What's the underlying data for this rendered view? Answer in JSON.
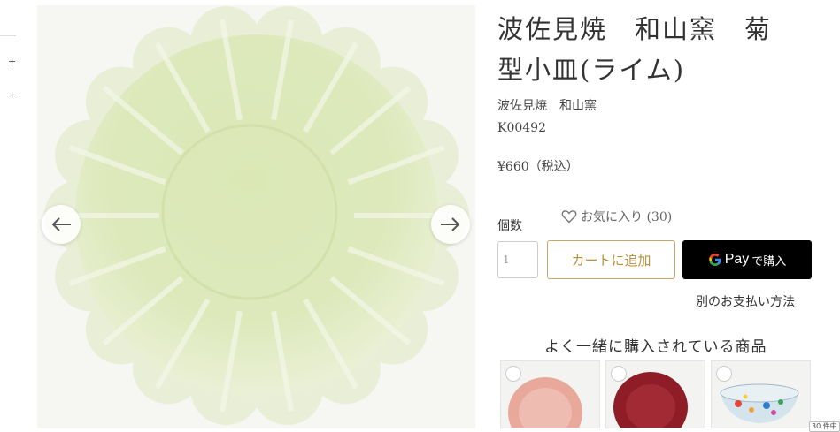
{
  "product": {
    "title_line1": "波佐見焼　和山窯　菊",
    "title_line2": "型小皿(ライム)",
    "maker": "波佐見焼　和山窯",
    "sku": "K00492",
    "price": "¥660（税込）"
  },
  "purchase": {
    "quantity_label": "個数",
    "favorite_label": "お気に入り (30)",
    "quantity_value": "1",
    "add_to_cart_label": "カートに追加",
    "gpay_label": "Pay",
    "gpay_buy_label": "で購入",
    "other_payment_label": "別のお支払い方法"
  },
  "related": {
    "title": "よく一緒に購入されている商品",
    "items": [
      {
        "name": "pink-plate",
        "color": "#e8a99a"
      },
      {
        "name": "red-plate",
        "color": "#8f1d27"
      },
      {
        "name": "glass-bowl",
        "color": "#d4e4ec"
      }
    ]
  },
  "badge": "30 件中",
  "colors": {
    "plate_lime": "#dbe9b8",
    "cart_border": "#c9a667",
    "cart_text": "#b88d3d",
    "gpay_bg": "#000000"
  }
}
